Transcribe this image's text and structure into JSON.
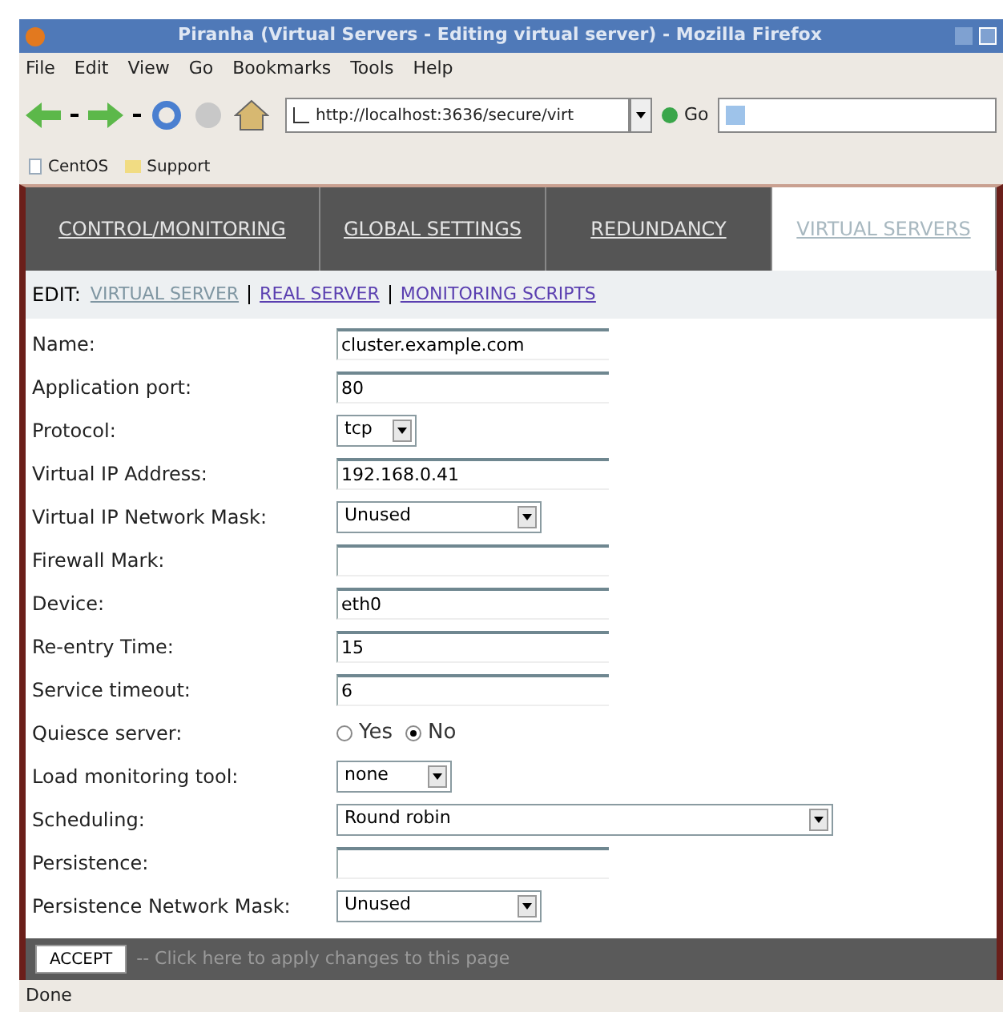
{
  "window": {
    "title": "Piranha (Virtual Servers - Editing virtual server) - Mozilla Firefox"
  },
  "menu": [
    "File",
    "Edit",
    "View",
    "Go",
    "Bookmarks",
    "Tools",
    "Help"
  ],
  "toolbar": {
    "url": "http://localhost:3636/secure/virt",
    "go": "Go"
  },
  "bookmarks": [
    {
      "label": "CentOS",
      "kind": "page"
    },
    {
      "label": "Support",
      "kind": "folder"
    }
  ],
  "tabs": [
    {
      "label": "CONTROL/MONITORING",
      "selected": false
    },
    {
      "label": "GLOBAL SETTINGS",
      "selected": false
    },
    {
      "label": "REDUNDANCY",
      "selected": false
    },
    {
      "label": "VIRTUAL SERVERS",
      "selected": true
    }
  ],
  "subnav": {
    "label": "EDIT:",
    "links": [
      {
        "label": "VIRTUAL SERVER",
        "selected": true
      },
      {
        "label": "REAL SERVER",
        "selected": false
      },
      {
        "label": "MONITORING SCRIPTS",
        "selected": false
      }
    ]
  },
  "fields": [
    {
      "label": "Name:",
      "kind": "text",
      "value": "cluster.example.com"
    },
    {
      "label": "Application port:",
      "kind": "text",
      "value": "80"
    },
    {
      "label": "Protocol:",
      "kind": "select",
      "value": "tcp"
    },
    {
      "label": "Virtual IP Address:",
      "kind": "text",
      "value": "192.168.0.41"
    },
    {
      "label": "Virtual IP Network Mask:",
      "kind": "select",
      "value": "Unused"
    },
    {
      "label": "Firewall Mark:",
      "kind": "text"
    },
    {
      "label": "Device:",
      "kind": "text",
      "value": "eth0"
    },
    {
      "label": "Re-entry Time:",
      "kind": "text",
      "value": "15"
    },
    {
      "label": "Service timeout:",
      "kind": "text",
      "value": "6"
    },
    {
      "label": "Quiesce server:",
      "kind": "radio",
      "options": [
        {
          "label": "Yes",
          "selected": false
        },
        {
          "label": "No",
          "selected": true
        }
      ]
    },
    {
      "label": "Load monitoring tool:",
      "kind": "select",
      "value": "none"
    },
    {
      "label": "Scheduling:",
      "kind": "select",
      "value": "Round robin"
    },
    {
      "label": "Persistence:",
      "kind": "text"
    },
    {
      "label": "Persistence Network Mask:",
      "kind": "select",
      "value": "Unused"
    }
  ],
  "accept": {
    "button": "ACCEPT",
    "hint": "-- Click here to apply changes to this page"
  },
  "status_bar": "Done"
}
